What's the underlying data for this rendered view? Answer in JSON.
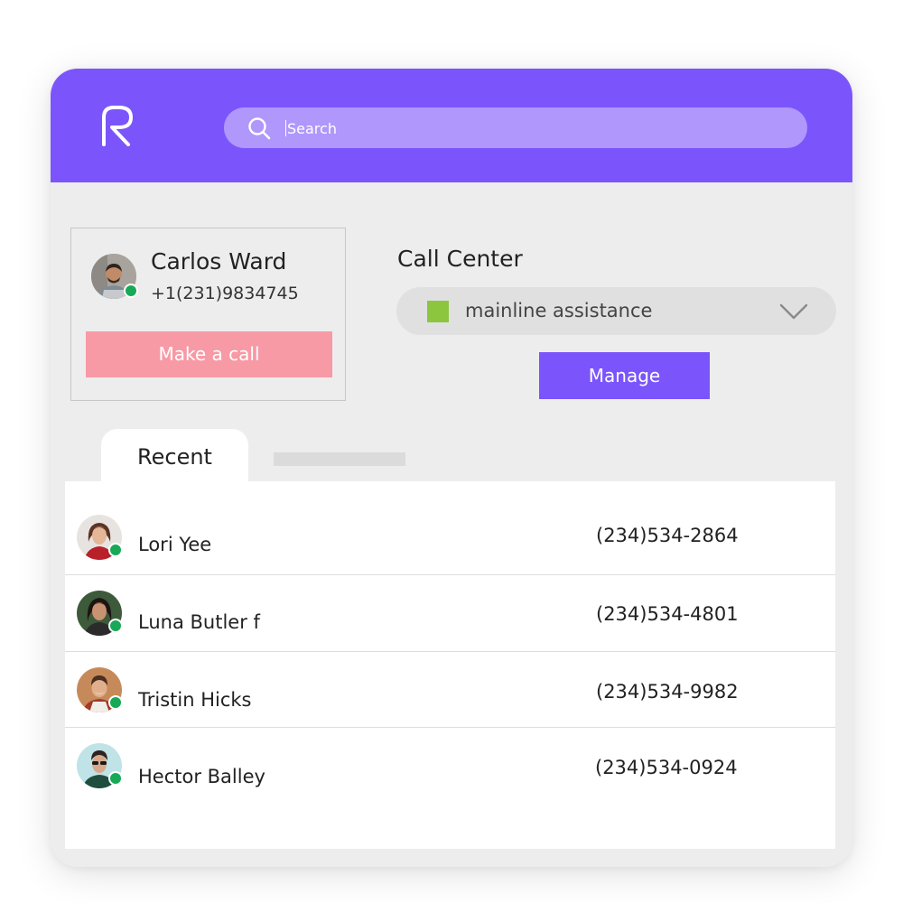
{
  "header": {
    "logo_icon": "r-logo-icon",
    "search": {
      "placeholder": "Search",
      "icon": "search-icon"
    }
  },
  "contact": {
    "name": "Carlos Ward",
    "phone": "+1(231)9834745",
    "status": "online",
    "call_label": "Make a call"
  },
  "call_center": {
    "title": "Call Center",
    "selected": "mainline assistance",
    "swatch_color": "#8cc63f",
    "manage_label": "Manage"
  },
  "tabs": {
    "recent_label": "Recent"
  },
  "recent": [
    {
      "name": "Lori Yee",
      "phone": "(234)534-2864",
      "status": "online"
    },
    {
      "name": "Luna Butler f",
      "phone": "(234)534-4801",
      "status": "online"
    },
    {
      "name": "Tristin Hicks",
      "phone": "(234)534-9982",
      "status": "online"
    },
    {
      "name": "Hector Balley",
      "phone": "(234)534-0924",
      "status": "online"
    }
  ],
  "colors": {
    "accent": "#7b55fb",
    "call_button": "#f79aa6",
    "online": "#18a957"
  }
}
